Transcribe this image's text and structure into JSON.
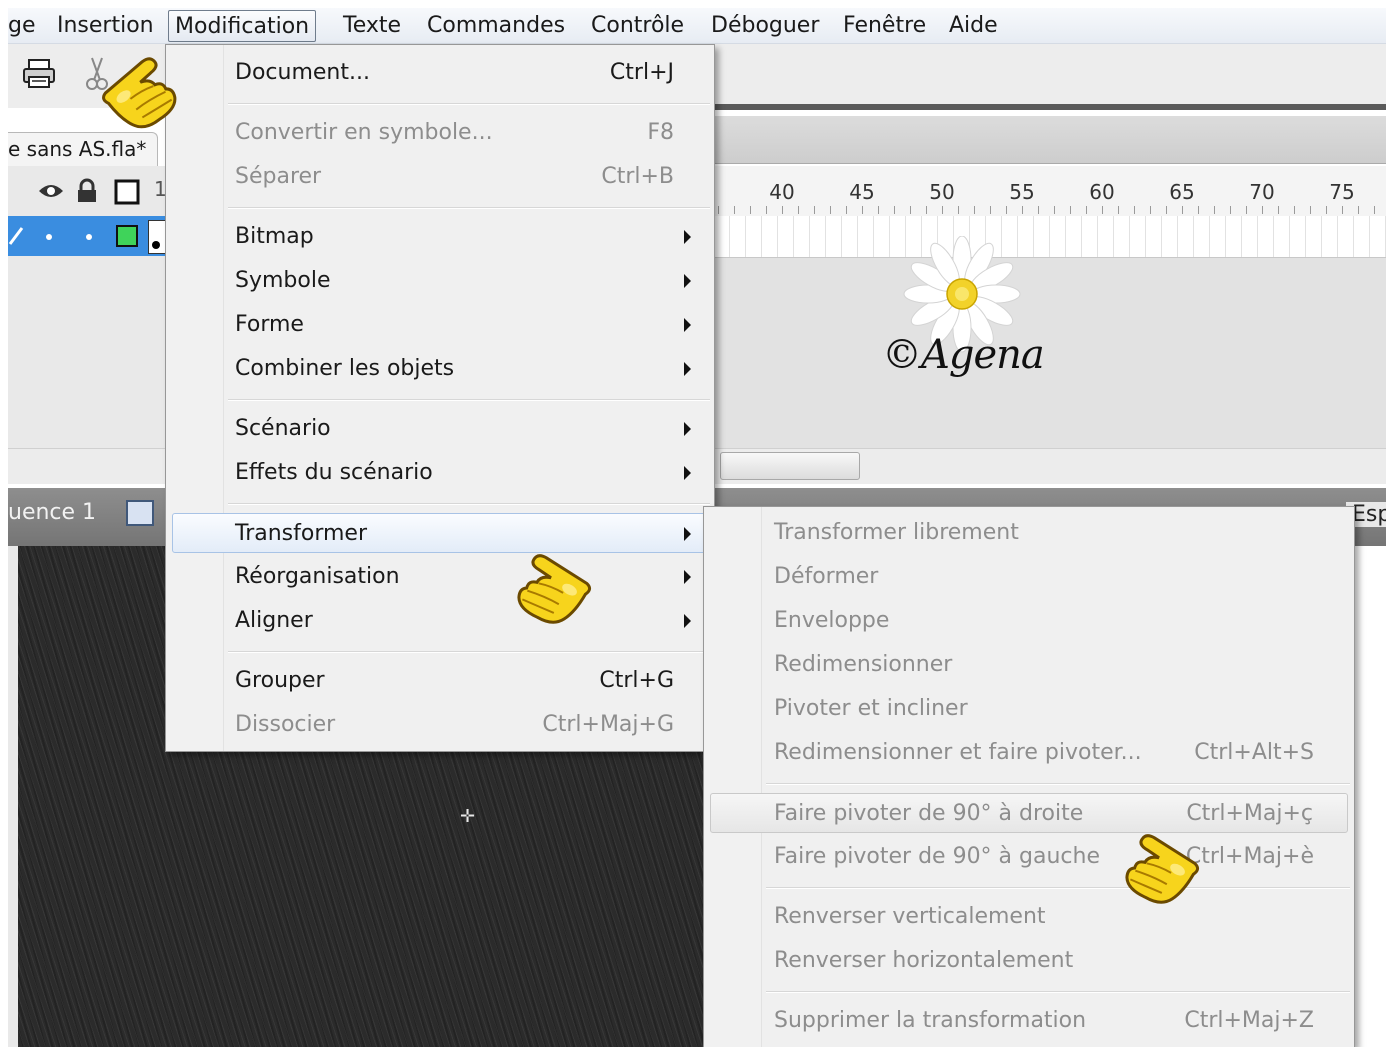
{
  "menubar": {
    "items": [
      "ge",
      "Insertion",
      "Modification",
      "Texte",
      "Commandes",
      "Contrôle",
      "Déboguer",
      "Fenêtre",
      "Aide"
    ]
  },
  "document": {
    "tab_title": "e sans AS.fla*"
  },
  "timeline": {
    "ruler_labels": [
      "40",
      "45",
      "50",
      "55",
      "60",
      "65",
      "70",
      "75"
    ],
    "frame_digit": "1"
  },
  "scene": {
    "label": "uence 1",
    "right_label": "Esp"
  },
  "watermark": {
    "text": "©Agena"
  },
  "modification_menu": {
    "items": [
      {
        "label": "Document...",
        "shortcut": "Ctrl+J",
        "enabled": true
      },
      {
        "label": "Convertir en symbole...",
        "shortcut": "F8",
        "enabled": false
      },
      {
        "label": "Séparer",
        "shortcut": "Ctrl+B",
        "enabled": false
      },
      {
        "label": "Bitmap",
        "submenu": true,
        "enabled": true
      },
      {
        "label": "Symbole",
        "submenu": true,
        "enabled": true
      },
      {
        "label": "Forme",
        "submenu": true,
        "enabled": true
      },
      {
        "label": "Combiner les objets",
        "submenu": true,
        "enabled": true
      },
      {
        "label": "Scénario",
        "submenu": true,
        "enabled": true
      },
      {
        "label": "Effets du scénario",
        "submenu": true,
        "enabled": true
      },
      {
        "label": "Transformer",
        "submenu": true,
        "enabled": true,
        "highlighted": true
      },
      {
        "label": "Réorganisation",
        "submenu": true,
        "enabled": true
      },
      {
        "label": "Aligner",
        "submenu": true,
        "enabled": true
      },
      {
        "label": "Grouper",
        "shortcut": "Ctrl+G",
        "enabled": true
      },
      {
        "label": "Dissocier",
        "shortcut": "Ctrl+Maj+G",
        "enabled": false
      }
    ]
  },
  "transformer_menu": {
    "items": [
      {
        "label": "Transformer librement",
        "shortcut": ""
      },
      {
        "label": "Déformer",
        "shortcut": ""
      },
      {
        "label": "Enveloppe",
        "shortcut": ""
      },
      {
        "label": "Redimensionner",
        "shortcut": ""
      },
      {
        "label": "Pivoter et incliner",
        "shortcut": ""
      },
      {
        "label": "Redimensionner et faire pivoter...",
        "shortcut": "Ctrl+Alt+S"
      },
      {
        "label": "Faire pivoter de 90° à droite",
        "shortcut": "Ctrl+Maj+ç",
        "highlighted": true
      },
      {
        "label": "Faire pivoter de 90° à gauche",
        "shortcut": "Ctrl+Maj+è"
      },
      {
        "label": "Renverser verticalement",
        "shortcut": ""
      },
      {
        "label": "Renverser horizontalement",
        "shortcut": ""
      },
      {
        "label": "Supprimer la transformation",
        "shortcut": "Ctrl+Maj+Z"
      }
    ]
  },
  "colors": {
    "layer_selected": "#3a8de0",
    "hand_yellow": "#f7d41c",
    "stage_dark": "#2b2b2b"
  },
  "icons": [
    "printer-icon",
    "scissors-icon",
    "eye-icon",
    "lock-icon",
    "outline-square-icon",
    "pencil-icon",
    "scene-icon",
    "pointing-hand-icon"
  ]
}
